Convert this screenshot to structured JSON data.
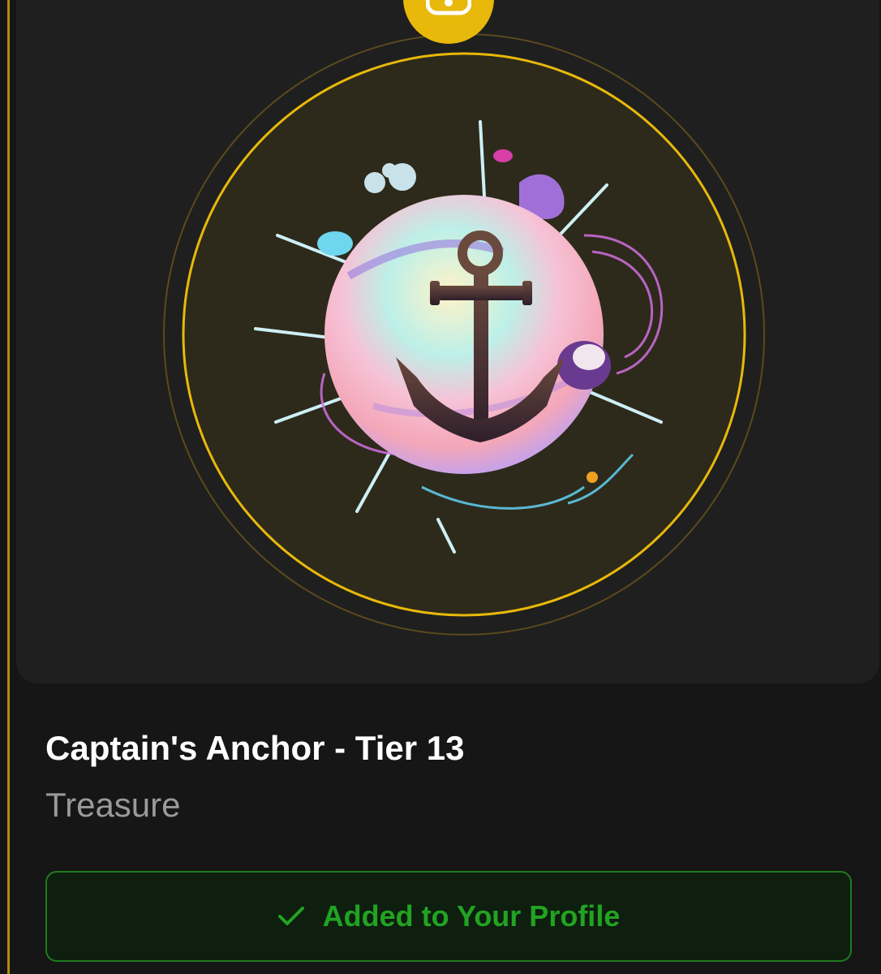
{
  "item": {
    "name": "Captain's Anchor - Tier 13",
    "category": "Treasure"
  },
  "status_button": {
    "label": "Added to Your Profile",
    "icon": "check-icon"
  },
  "badge": {
    "icon": "lock-icon"
  },
  "colors": {
    "accent_gold": "#e8b80a",
    "border_gold": "#b48a12",
    "success_green": "#22a322",
    "background": "#141414"
  }
}
